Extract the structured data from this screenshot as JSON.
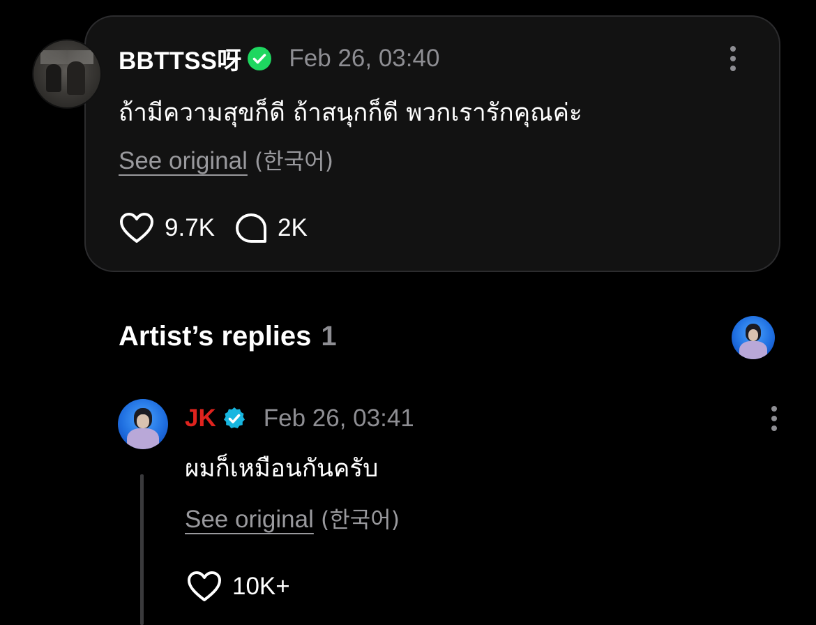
{
  "post": {
    "username": "BBTTSS呀",
    "timestamp": "Feb 26, 03:40",
    "text": "ถ้ามีความสุขก็ดี ถ้าสนุกก็ดี พวกเรารักคุณค่ะ",
    "see_original": "See original",
    "language": "(한국어)",
    "likes": "9.7K",
    "comments": "2K",
    "verified_badge_color": "#1ed760"
  },
  "artist_replies": {
    "title": "Artist’s replies",
    "count": "1"
  },
  "reply": {
    "artist_name": "JK",
    "artist_name_color": "#e0231e",
    "verified_badge_color": "#17b6e0",
    "timestamp": "Feb 26, 03:41",
    "text": "ผมก็เหมือนกันครับ",
    "see_original": "See original",
    "language": "(한국어)",
    "likes": "10K+"
  },
  "icons": {
    "more": "more-vertical-icon",
    "like": "heart-icon",
    "comment": "comment-bubble-icon",
    "verified": "verified-check-icon"
  }
}
